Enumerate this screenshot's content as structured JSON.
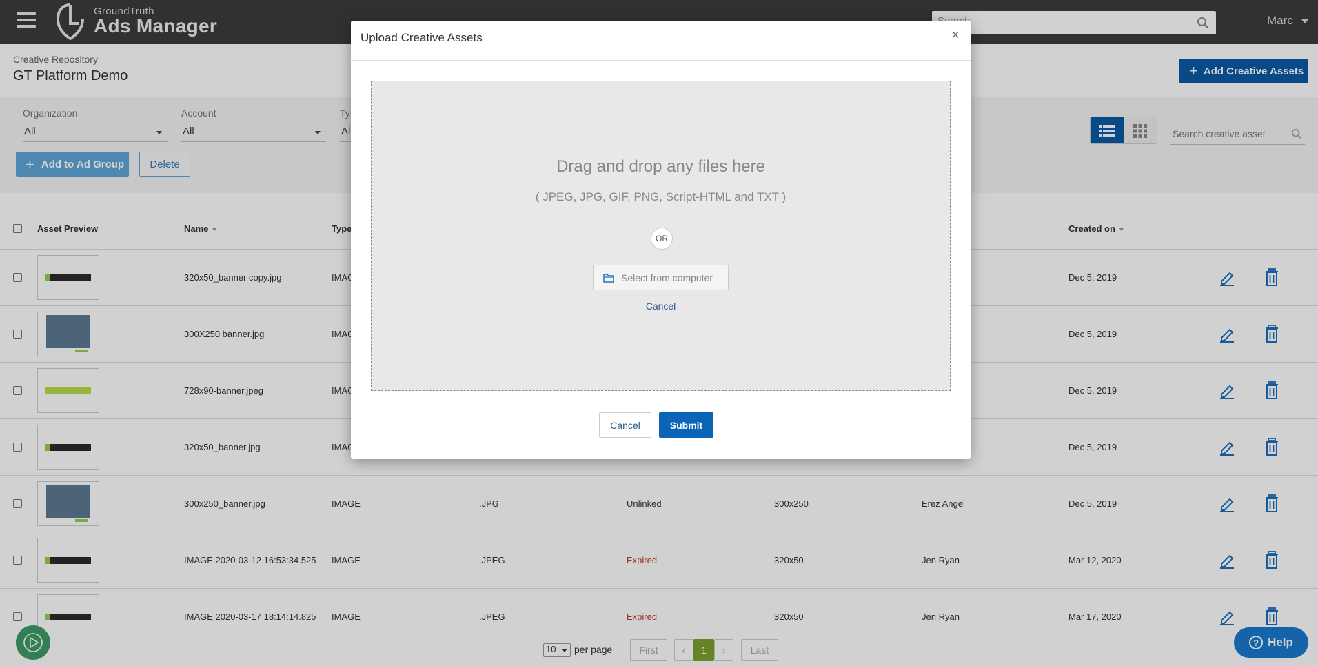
{
  "header": {
    "brand_small": "GroundTruth",
    "brand_big": "Ads Manager",
    "search_placeholder": "Search",
    "user_name": "Marc"
  },
  "subheader": {
    "breadcrumb": "Creative Repository",
    "title": "GT Platform Demo",
    "add_assets_label": "Add Creative Assets"
  },
  "filters": {
    "organization": {
      "label": "Organization",
      "value": "All"
    },
    "account": {
      "label": "Account",
      "value": "All"
    },
    "type": {
      "label": "Ty",
      "value": "Al"
    },
    "add_to_group_label": "Add to Ad Group",
    "delete_label": "Delete",
    "asset_search_placeholder": "Search creative asset"
  },
  "table": {
    "columns": {
      "asset_preview": "Asset Preview",
      "name": "Name",
      "type": "Type",
      "created_on": "Created on"
    },
    "rows": [
      {
        "thumb": "wide",
        "name": "320x50_banner copy.jpg",
        "type": "IMAGE",
        "ext": "",
        "status": "",
        "size": "",
        "owner": "",
        "created": "Dec 5, 2019"
      },
      {
        "thumb": "square",
        "name": "300X250 banner.jpg",
        "type": "IMAGE",
        "ext": "",
        "status": "",
        "size": "",
        "owner": "",
        "created": "Dec 5, 2019"
      },
      {
        "thumb": "lime",
        "name": "728x90-banner.jpeg",
        "type": "IMAGE",
        "ext": "",
        "status": "",
        "size": "",
        "owner": "",
        "created": "Dec 5, 2019"
      },
      {
        "thumb": "wide",
        "name": "320x50_banner.jpg",
        "type": "IMAGE",
        "ext": "",
        "status": "",
        "size": "",
        "owner": "",
        "created": "Dec 5, 2019"
      },
      {
        "thumb": "square",
        "name": "300x250_banner.jpg",
        "type": "IMAGE",
        "ext": ".JPG",
        "status": "Unlinked",
        "size": "300x250",
        "owner": "Erez Angel",
        "created": "Dec 5, 2019"
      },
      {
        "thumb": "wide",
        "name": "IMAGE 2020-03-12 16:53:34.525",
        "type": "IMAGE",
        "ext": ".JPEG",
        "status": "Expired",
        "size": "320x50",
        "owner": "Jen Ryan",
        "created": "Mar 12, 2020"
      },
      {
        "thumb": "wide",
        "name": "IMAGE 2020-03-17 18:14:14.825",
        "type": "IMAGE",
        "ext": ".JPEG",
        "status": "Expired",
        "size": "320x50",
        "owner": "Jen Ryan",
        "created": "Mar 17, 2020"
      }
    ]
  },
  "modal": {
    "title": "Upload Creative Assets",
    "close": "×",
    "drop_title": "Drag and drop any files here",
    "drop_types": "( JPEG, JPG, GIF, PNG, Script-HTML and TXT )",
    "or_label": "OR",
    "select_label": "Select from computer",
    "inner_cancel_label": "Cancel",
    "cancel_label": "Cancel",
    "submit_label": "Submit"
  },
  "pagination": {
    "per_page_value": "10",
    "per_page_label": "per page",
    "first": "First",
    "prev": "‹",
    "current": "1",
    "next": "›",
    "last": "Last"
  },
  "help_label": "Help",
  "colors": {
    "brand_blue": "#0a5aa6",
    "expired_red": "#c0392b",
    "active_page_green": "#7aa12f"
  }
}
